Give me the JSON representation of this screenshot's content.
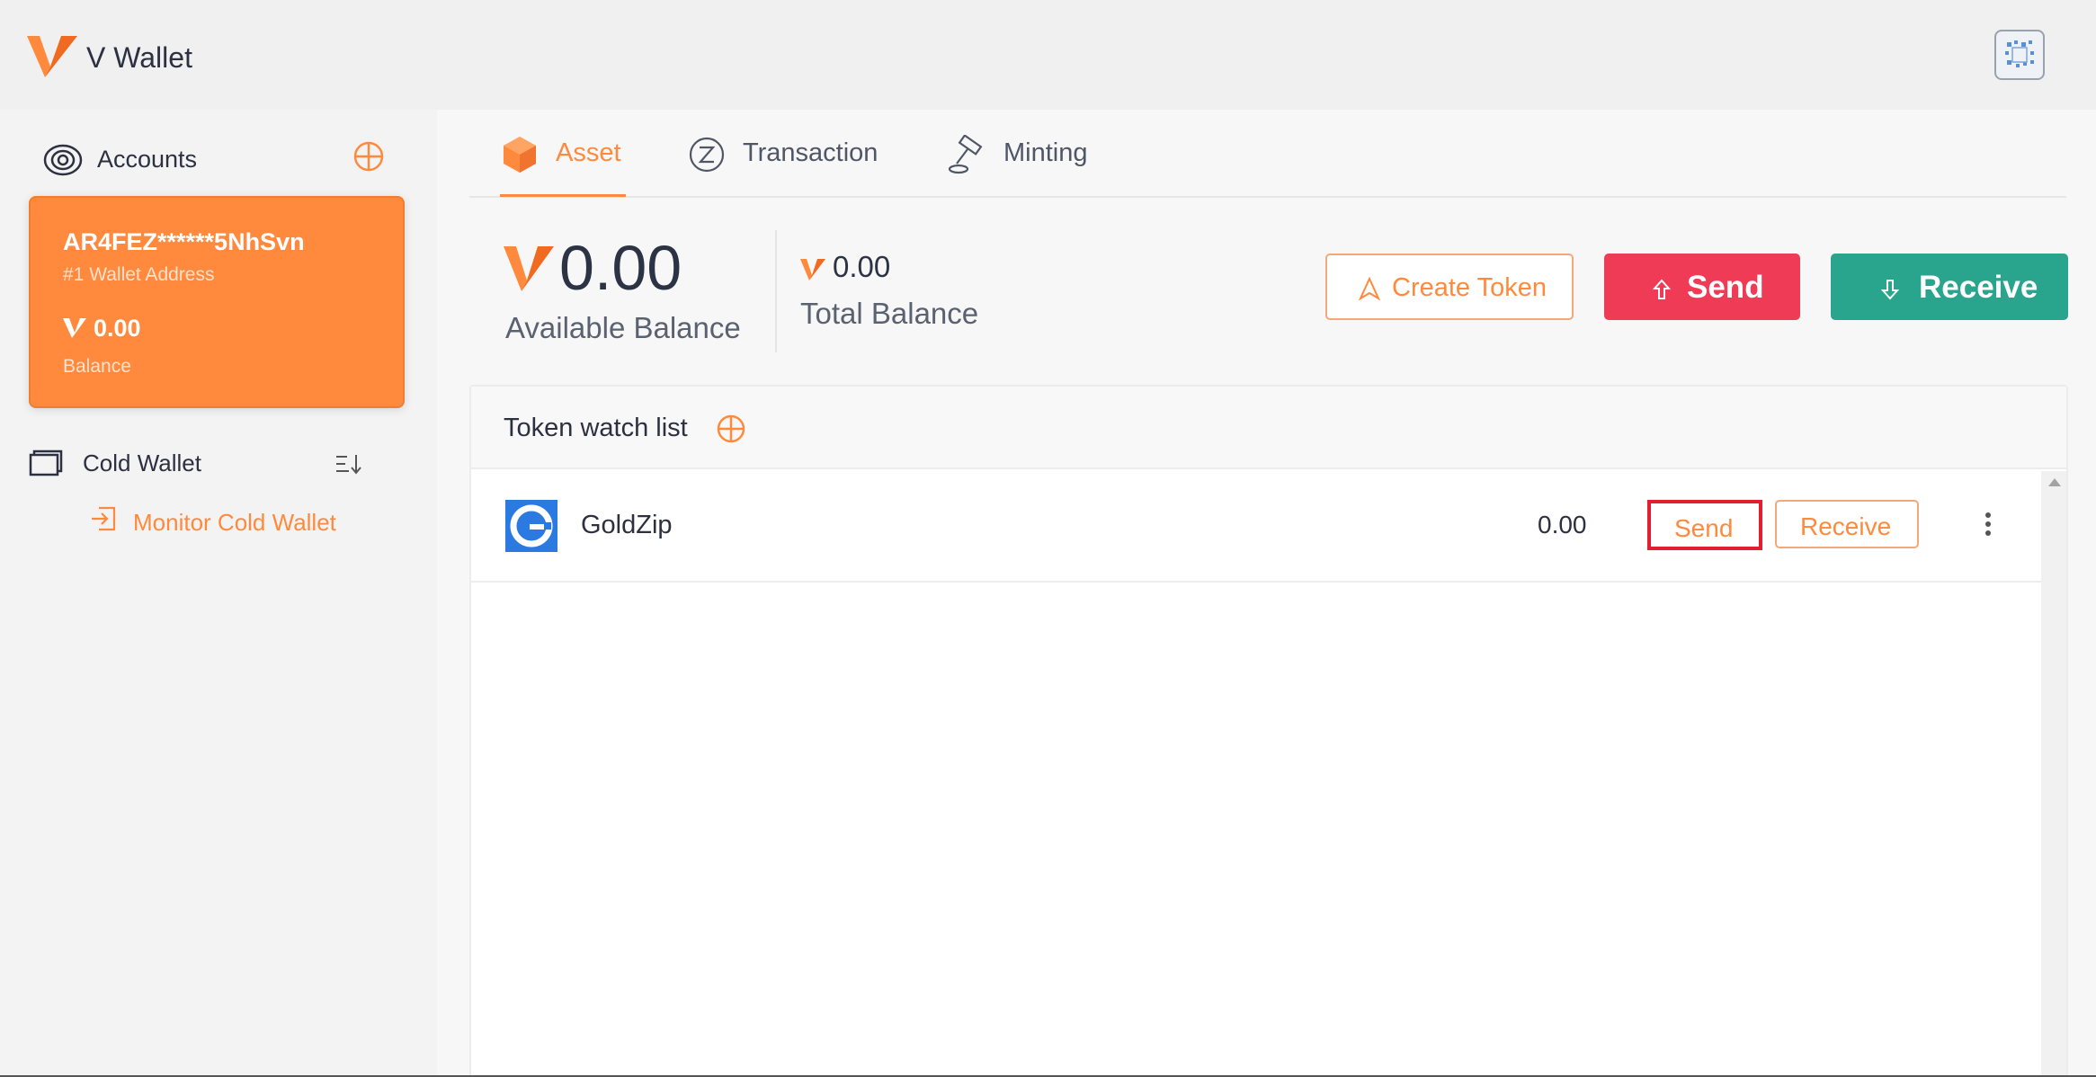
{
  "header": {
    "app_title": "V Wallet"
  },
  "sidebar": {
    "accounts_title": "Accounts",
    "account": {
      "address": "AR4FEZ******5NhSvn",
      "address_sub": "#1 Wallet Address",
      "balance": "0.00",
      "balance_label": "Balance"
    },
    "cold_wallet_title": "Cold Wallet",
    "monitor_label": "Monitor Cold Wallet"
  },
  "tabs": [
    {
      "label": "Asset",
      "active": true
    },
    {
      "label": "Transaction",
      "active": false
    },
    {
      "label": "Minting",
      "active": false
    }
  ],
  "balances": {
    "available_value": "0.00",
    "available_label": "Available Balance",
    "total_value": "0.00",
    "total_label": "Total Balance"
  },
  "actions": {
    "create_token": "Create Token",
    "send": "Send",
    "receive": "Receive"
  },
  "watchlist": {
    "title": "Token watch list",
    "tokens": [
      {
        "name": "GoldZip",
        "amount": "0.00",
        "send_label": "Send",
        "receive_label": "Receive"
      }
    ]
  },
  "colors": {
    "accent": "#ff8a3d",
    "send": "#ef3b56",
    "receive": "#2aa58d",
    "highlight": "#e02030"
  }
}
